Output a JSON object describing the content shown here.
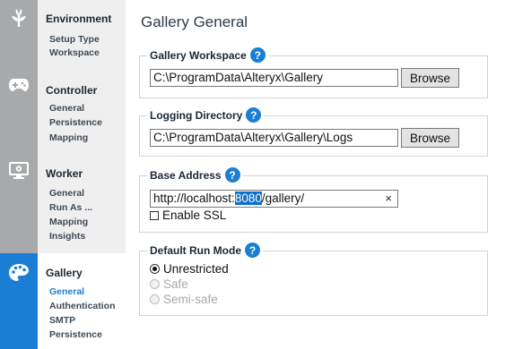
{
  "rail": {
    "icons": [
      "leaf-icon",
      "gamepad-icon",
      "monitor-gear-icon",
      "palette-icon"
    ]
  },
  "nav": {
    "environment": {
      "title": "Environment",
      "items": [
        "Setup Type",
        "Workspace"
      ]
    },
    "controller": {
      "title": "Controller",
      "items": [
        "General",
        "Persistence",
        "Mapping"
      ]
    },
    "worker": {
      "title": "Worker",
      "items": [
        "General",
        "Run As ...",
        "Mapping",
        "Insights"
      ]
    },
    "gallery": {
      "title": "Gallery",
      "items": [
        "General",
        "Authentication",
        "SMTP",
        "Persistence"
      ],
      "selected": "General"
    }
  },
  "page": {
    "title": "Gallery General"
  },
  "workspace": {
    "label": "Gallery Workspace",
    "help": "?",
    "value": "C:\\ProgramData\\Alteryx\\Gallery",
    "browse": "Browse"
  },
  "logging": {
    "label": "Logging Directory",
    "help": "?",
    "value": "C:\\ProgramData\\Alteryx\\Gallery\\Logs",
    "browse": "Browse"
  },
  "base_address": {
    "label": "Base Address",
    "help": "?",
    "value_prefix": "http://localhost:",
    "value_selected": "8080",
    "value_suffix": "/gallery/",
    "clear": "×",
    "enable_ssl": {
      "label": "Enable SSL",
      "checked": false
    }
  },
  "run_mode": {
    "label": "Default Run Mode",
    "help": "?",
    "options": [
      {
        "label": "Unrestricted",
        "selected": true,
        "enabled": true
      },
      {
        "label": "Safe",
        "selected": false,
        "enabled": false
      },
      {
        "label": "Semi-safe",
        "selected": false,
        "enabled": false
      }
    ]
  },
  "colors": {
    "accent": "#1a7fd4",
    "rail": "#a7a9ab",
    "nav_bg": "#efefef"
  }
}
